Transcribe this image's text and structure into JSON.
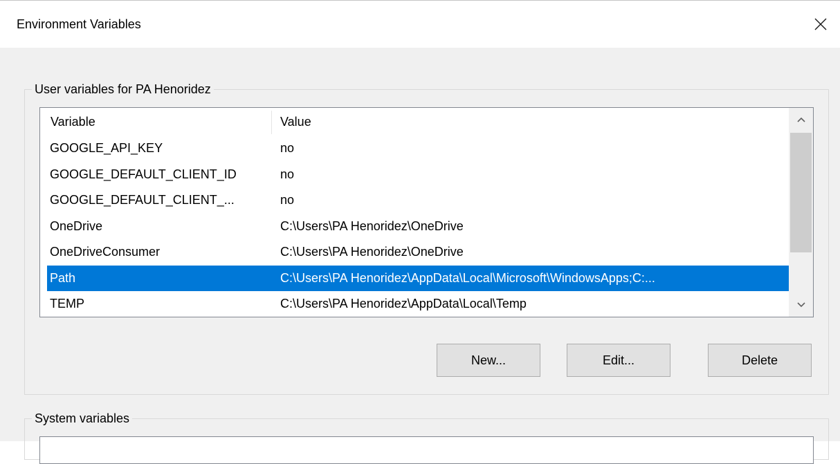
{
  "window": {
    "title": "Environment Variables"
  },
  "user_group": {
    "legend": "User variables for PA Henoridez",
    "columns": {
      "variable": "Variable",
      "value": "Value"
    },
    "rows": [
      {
        "variable": "GOOGLE_API_KEY",
        "value": "no"
      },
      {
        "variable": "GOOGLE_DEFAULT_CLIENT_ID",
        "value": "no"
      },
      {
        "variable": "GOOGLE_DEFAULT_CLIENT_...",
        "value": "no"
      },
      {
        "variable": "OneDrive",
        "value": "C:\\Users\\PA Henoridez\\OneDrive"
      },
      {
        "variable": "OneDriveConsumer",
        "value": "C:\\Users\\PA Henoridez\\OneDrive"
      },
      {
        "variable": "Path",
        "value": "C:\\Users\\PA Henoridez\\AppData\\Local\\Microsoft\\WindowsApps;C:...",
        "selected": true
      },
      {
        "variable": "TEMP",
        "value": "C:\\Users\\PA Henoridez\\AppData\\Local\\Temp"
      }
    ],
    "buttons": {
      "new": "New...",
      "edit": "Edit...",
      "delete": "Delete"
    }
  },
  "system_group": {
    "legend": "System variables"
  },
  "icons": {
    "close": "close-icon",
    "scroll_up": "chevron-up-icon",
    "scroll_down": "chevron-down-icon"
  },
  "colors": {
    "selection": "#0078d7",
    "dialog_background": "#f0f0f0",
    "button_face": "#e1e1e1"
  }
}
